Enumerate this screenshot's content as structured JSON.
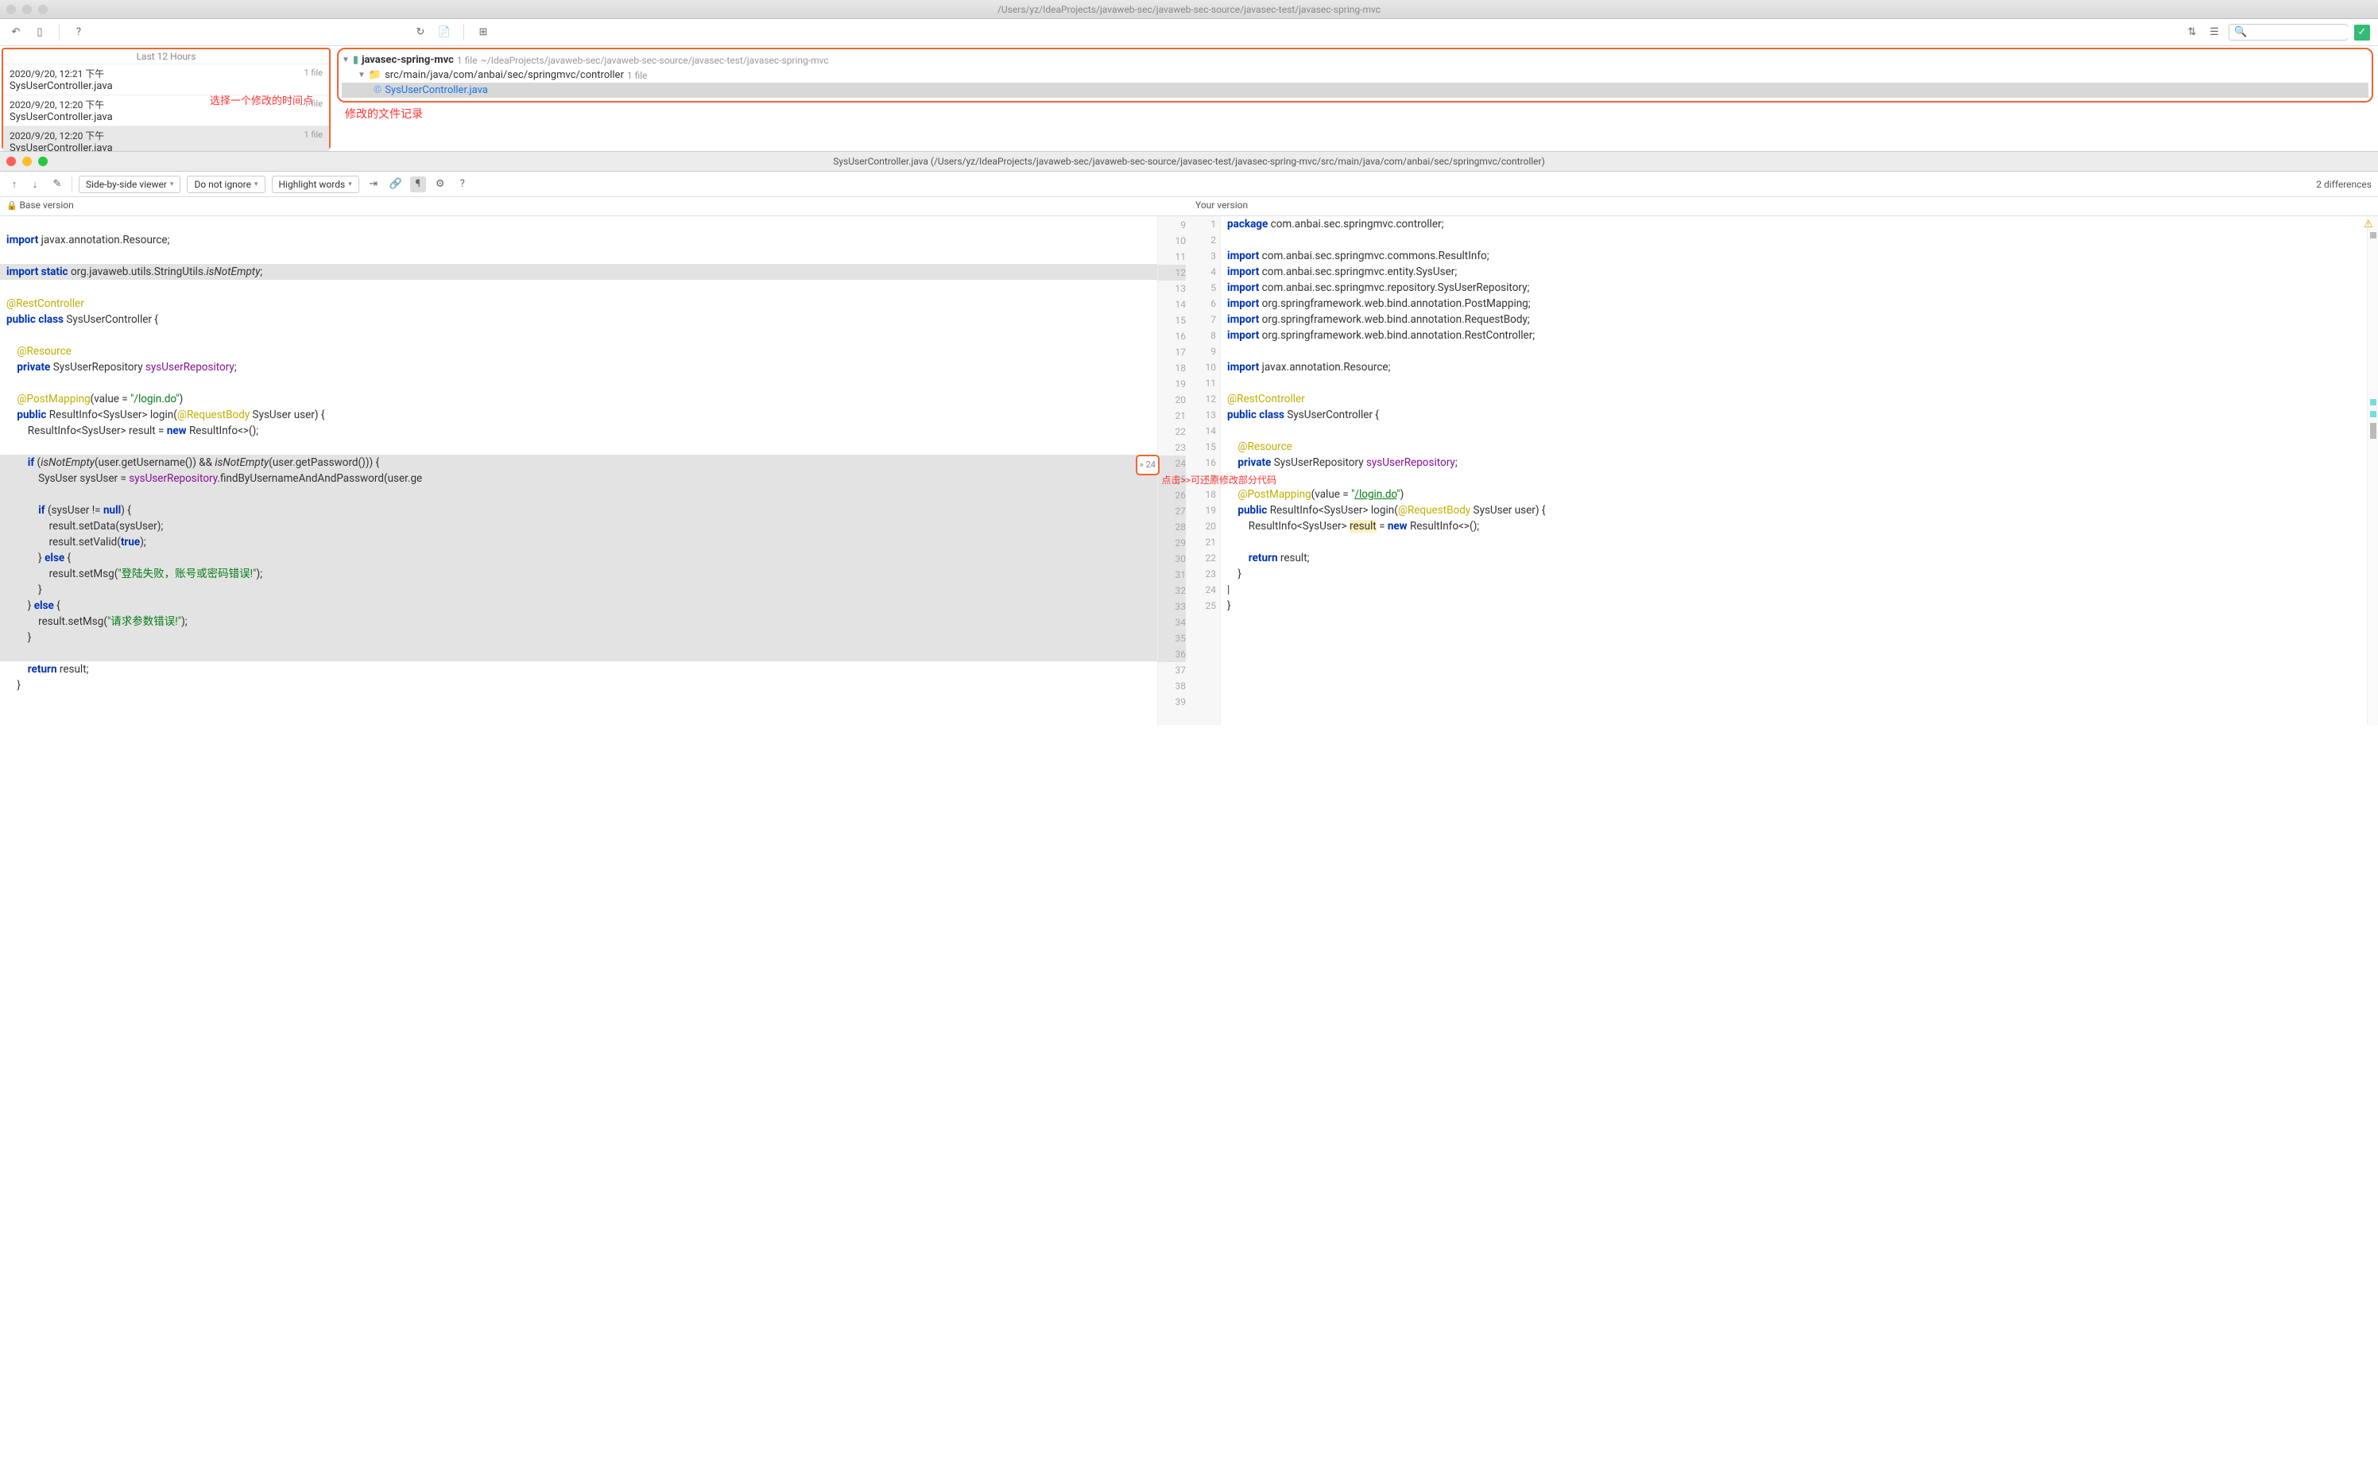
{
  "window": {
    "title_path": "/Users/yz/IdeaProjects/javaweb-sec/javaweb-sec-source/javasec-test/javasec-spring-mvc"
  },
  "toolbar": {
    "search_placeholder": ""
  },
  "history": {
    "header": "Last 12 Hours",
    "items": [
      {
        "time": "2020/9/20, 12:21 下午",
        "file": "SysUserController.java",
        "count": "1 file"
      },
      {
        "time": "2020/9/20, 12:20 下午",
        "file": "SysUserController.java",
        "count": "1 file"
      },
      {
        "time": "2020/9/20, 12:20 下午",
        "file": "SysUserController.java",
        "count": "1 file"
      }
    ],
    "annotation": "选择一个修改的时间点"
  },
  "file_tree": {
    "root": {
      "name": "javasec-spring-mvc",
      "meta1": "1 file",
      "meta2": "~/IdeaProjects/javaweb-sec/javaweb-sec-source/javasec-test/javasec-spring-mvc"
    },
    "sub": {
      "name": "src/main/java/com/anbai/sec/springmvc/controller",
      "meta": "1 file"
    },
    "file": {
      "name": "SysUserController.java"
    },
    "annotation": "修改的文件记录"
  },
  "diff": {
    "title": "SysUserController.java (/Users/yz/IdeaProjects/javaweb-sec/javaweb-sec-source/javasec-test/javasec-spring-mvc/src/main/java/com/anbai/sec/springmvc/controller)",
    "viewer_mode": "Side-by-side viewer",
    "ignore_mode": "Do not ignore",
    "highlight_mode": "Highlight words",
    "diff_count": "2 differences",
    "base_label": "Base version",
    "your_label": "Your version",
    "apply_number": "24",
    "annotation": "点击>>可还原修改部分代码"
  },
  "left_code": {
    "gutter_start": 9,
    "lines": [
      {
        "n": 9,
        "html": ""
      },
      {
        "n": 10,
        "html": "<span class='kw'>import</span> javax.annotation.Resource;"
      },
      {
        "n": 11,
        "html": ""
      },
      {
        "n": 12,
        "html": "<span class='kw'>import static</span> org.javaweb.utils.StringUtils.<span class='mtd'>isNotEmpty</span>;",
        "cls": "diff-block-del"
      },
      {
        "n": 13,
        "html": ""
      },
      {
        "n": 14,
        "html": "<span class='ann'>@RestController</span>"
      },
      {
        "n": 15,
        "html": "<span class='kw'>public class</span> SysUserController {"
      },
      {
        "n": 16,
        "html": ""
      },
      {
        "n": 17,
        "html": "    <span class='ann'>@Resource</span>"
      },
      {
        "n": 18,
        "html": "    <span class='kw'>private</span> SysUserRepository <span class='fld'>sysUserRepository</span>;"
      },
      {
        "n": 19,
        "html": ""
      },
      {
        "n": 20,
        "html": "    <span class='ann'>@PostMapping</span>(value = <span class='str'>\"/login.do\"</span>)"
      },
      {
        "n": 21,
        "html": "    <span class='kw'>public</span> ResultInfo&lt;SysUser&gt; login(<span class='ann'>@RequestBody</span> SysUser user) {"
      },
      {
        "n": 22,
        "html": "        ResultInfo&lt;SysUser&gt; result = <span class='kw'>new</span> ResultInfo&lt;&gt;();"
      },
      {
        "n": 23,
        "html": ""
      },
      {
        "n": 24,
        "html": "        <span class='kw'>if</span> (<span class='mtd'>isNotEmpty</span>(user.getUsername()) && <span class='mtd'>isNotEmpty</span>(user.getPassword())) {",
        "cls": "diff-block-del",
        "apply": true
      },
      {
        "n": 25,
        "html": "            SysUser sysUser = <span class='fld'>sysUserRepository</span>.findByUsernameAndAndPassword(user.ge",
        "cls": "diff-block-del"
      },
      {
        "n": 26,
        "html": "",
        "cls": "diff-block-del"
      },
      {
        "n": 27,
        "html": "            <span class='kw'>if</span> (sysUser != <span class='kw'>null</span>) {",
        "cls": "diff-block-del"
      },
      {
        "n": 28,
        "html": "                result.setData(sysUser);",
        "cls": "diff-block-del"
      },
      {
        "n": 29,
        "html": "                result.setValid(<span class='kw'>true</span>);",
        "cls": "diff-block-del"
      },
      {
        "n": 30,
        "html": "            } <span class='kw'>else</span> {",
        "cls": "diff-block-del"
      },
      {
        "n": 31,
        "html": "                result.setMsg(<span class='str'>\"登陆失败，账号或密码错误!\"</span>);",
        "cls": "diff-block-del"
      },
      {
        "n": 32,
        "html": "            }",
        "cls": "diff-block-del"
      },
      {
        "n": 33,
        "html": "        } <span class='kw'>else</span> {",
        "cls": "diff-block-del"
      },
      {
        "n": 34,
        "html": "            result.setMsg(<span class='str'>\"请求参数错误!\"</span>);",
        "cls": "diff-block-del"
      },
      {
        "n": 35,
        "html": "        }",
        "cls": "diff-block-del"
      },
      {
        "n": 36,
        "html": "",
        "cls": "diff-block-del"
      },
      {
        "n": 37,
        "html": "        <span class='kw'>return</span> result;"
      },
      {
        "n": 38,
        "html": "    }"
      },
      {
        "n": 39,
        "html": ""
      }
    ]
  },
  "right_code": {
    "lines": [
      {
        "n": 1,
        "html": "<span class='kw'>package</span> com.anbai.sec.springmvc.controller;"
      },
      {
        "n": 2,
        "html": ""
      },
      {
        "n": 3,
        "html": "<span class='kw'>import</span> com.anbai.sec.springmvc.commons.ResultInfo;"
      },
      {
        "n": 4,
        "html": "<span class='kw'>import</span> com.anbai.sec.springmvc.entity.SysUser;"
      },
      {
        "n": 5,
        "html": "<span class='kw'>import</span> com.anbai.sec.springmvc.repository.SysUserRepository;"
      },
      {
        "n": 6,
        "html": "<span class='kw'>import</span> org.springframework.web.bind.annotation.PostMapping;"
      },
      {
        "n": 7,
        "html": "<span class='kw'>import</span> org.springframework.web.bind.annotation.RequestBody;"
      },
      {
        "n": 8,
        "html": "<span class='kw'>import</span> org.springframework.web.bind.annotation.RestController;"
      },
      {
        "n": 9,
        "html": ""
      },
      {
        "n": 10,
        "html": "<span class='kw'>import</span> javax.annotation.Resource;"
      },
      {
        "n": 11,
        "html": ""
      },
      {
        "n": 12,
        "html": "<span class='ann'>@RestController</span>"
      },
      {
        "n": 13,
        "html": "<span class='kw'>public class</span> SysUserController {"
      },
      {
        "n": 14,
        "html": ""
      },
      {
        "n": 15,
        "html": "    <span class='ann'>@Resource</span>"
      },
      {
        "n": 16,
        "html": "    <span class='kw'>private</span> SysUserRepository <span class='fld'>sysUserRepository</span>;"
      },
      {
        "n": 17,
        "html": ""
      },
      {
        "n": 18,
        "html": "    <span class='ann'>@PostMapping</span>(value = <span class='str'>\"<u>/login.do</u>\"</span>)"
      },
      {
        "n": 19,
        "html": "    <span class='kw'>public</span> ResultInfo&lt;SysUser&gt; login(<span class='ann'>@RequestBody</span> SysUser user) {"
      },
      {
        "n": 20,
        "html": "        ResultInfo&lt;SysUser&gt; <span style='background:#fff2c0'>result</span> = <span class='kw'>new</span> ResultInfo&lt;&gt;();"
      },
      {
        "n": 21,
        "html": ""
      },
      {
        "n": 22,
        "html": "        <span class='kw'>return</span> result;"
      },
      {
        "n": 23,
        "html": "    }"
      },
      {
        "n": 24,
        "html": "|"
      },
      {
        "n": 25,
        "html": "}"
      }
    ]
  }
}
